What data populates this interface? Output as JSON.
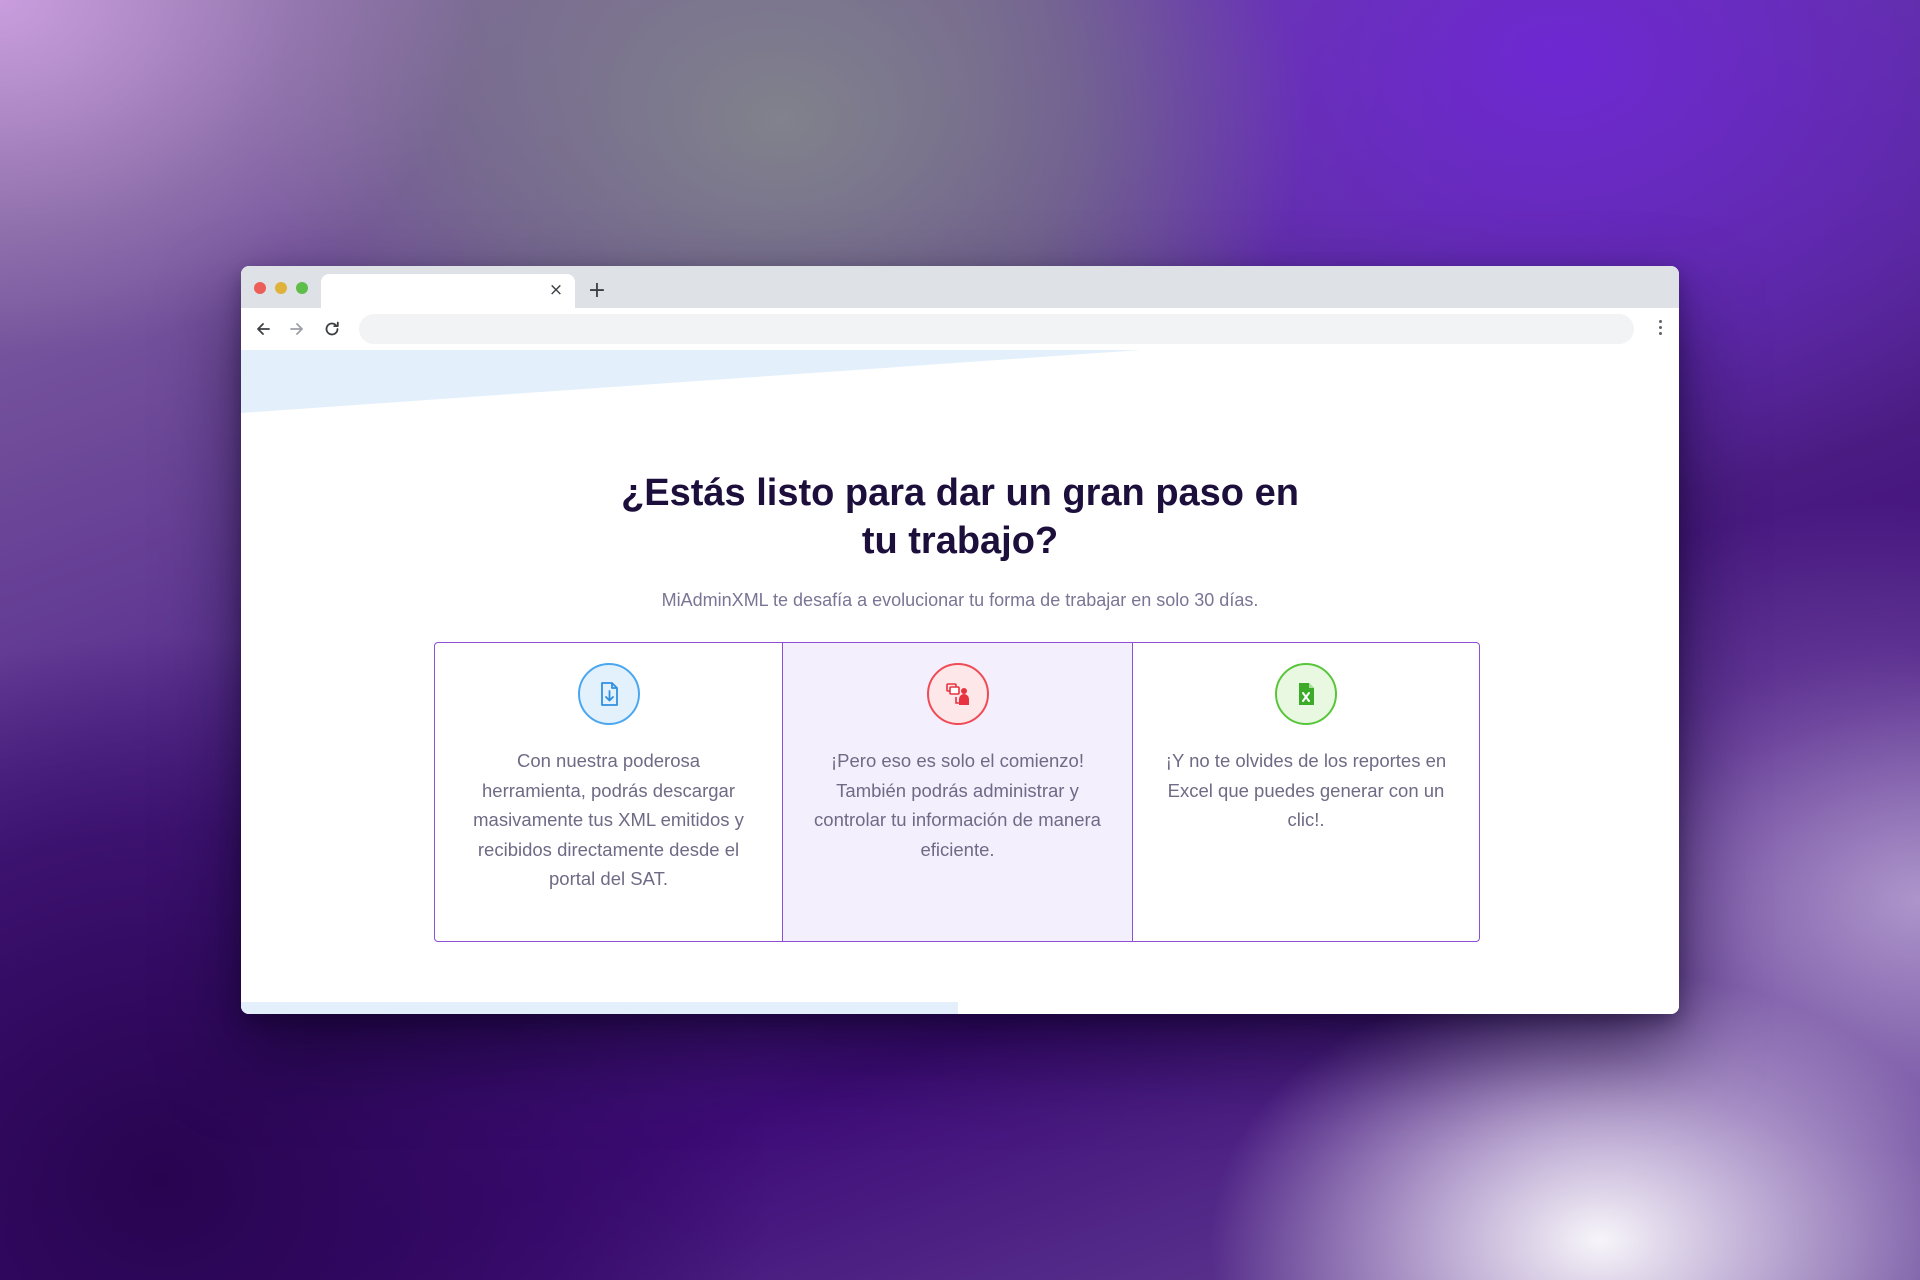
{
  "browser": {
    "tab_close": "×",
    "new_tab": "+"
  },
  "page": {
    "heading_line1": "¿Estás listo para dar un gran paso en",
    "heading_line2": "tu trabajo?",
    "subtitle": "MiAdminXML te desafía a evolucionar tu forma de trabajar en solo 30 días.",
    "cards": [
      {
        "icon": "file-download-icon",
        "accent": "#4aa6ef",
        "text": "Con nuestra poderosa herramienta, podrás descargar masivamente tus XML emitidos y recibidos directamente desde el portal del SAT."
      },
      {
        "icon": "document-management-icon",
        "accent": "#f04a55",
        "text": "¡Pero eso es solo el comienzo! También podrás administrar y controlar tu información de manera eficiente."
      },
      {
        "icon": "excel-file-icon",
        "accent": "#58c63a",
        "text": "¡Y no te olvides de los reportes en Excel que puedes generar con un clic!."
      }
    ]
  },
  "colors": {
    "heading": "#1d0f3c",
    "body_text": "#6f6a85",
    "card_border": "#8d4fd6",
    "highlight_card_bg": "#f4effd",
    "decor_band": "#e3f0fb"
  }
}
